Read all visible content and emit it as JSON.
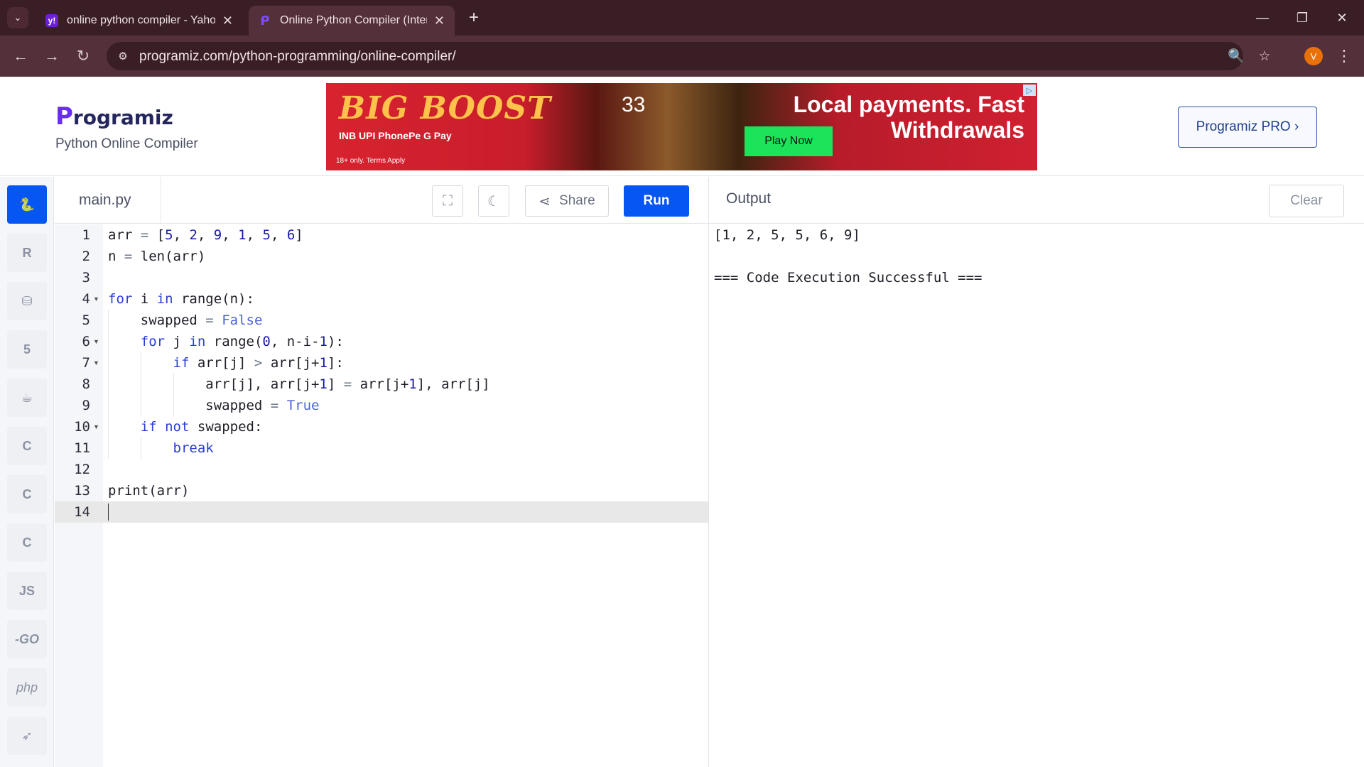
{
  "browser": {
    "tabs": [
      {
        "title": "online python compiler - Yahoo",
        "favicon": "yahoo-icon",
        "active": false
      },
      {
        "title": "Online Python Compiler (Interp",
        "favicon": "programiz-icon",
        "active": true
      }
    ],
    "url": "programiz.com/python-programming/online-compiler/",
    "profile_initial": "V",
    "accent_color": "#54303a"
  },
  "header": {
    "logo_text": "rogramiz",
    "logo_initial": "P",
    "subtitle": "Python Online Compiler",
    "pro_button": "Programiz PRO ›"
  },
  "ad": {
    "headline_left": "BIG BOOST",
    "payment_logos": "INB    UPI    PhonePe    G Pay",
    "terms": "18+ only. Terms Apply",
    "number": "33",
    "headline_right": "Local payments. Fast Withdrawals",
    "cta": "Play Now"
  },
  "sidebar": {
    "languages": [
      {
        "name": "python",
        "icon": "python-icon",
        "label": "🐍",
        "active": true
      },
      {
        "name": "r",
        "icon": "r-icon",
        "label": "R"
      },
      {
        "name": "sql",
        "icon": "database-icon",
        "label": "⛁"
      },
      {
        "name": "html",
        "icon": "html5-icon",
        "label": "5"
      },
      {
        "name": "java",
        "icon": "java-icon",
        "label": "☕"
      },
      {
        "name": "c",
        "icon": "c-icon",
        "label": "C"
      },
      {
        "name": "cpp",
        "icon": "cpp-icon",
        "label": "C"
      },
      {
        "name": "csharp",
        "icon": "csharp-icon",
        "label": "C"
      },
      {
        "name": "javascript",
        "icon": "js-icon",
        "label": "JS"
      },
      {
        "name": "go",
        "icon": "go-icon",
        "label": "-GO"
      },
      {
        "name": "php",
        "icon": "php-icon",
        "label": "php"
      },
      {
        "name": "swift",
        "icon": "swift-icon",
        "label": "➶"
      }
    ]
  },
  "editor": {
    "filename": "main.py",
    "share_label": "Share",
    "run_label": "Run",
    "run_color": "#0556f3",
    "current_line": 14,
    "lines": [
      "arr = [5, 2, 9, 1, 5, 6]",
      "n = len(arr)",
      "",
      "for i in range(n):",
      "    swapped = False",
      "    for j in range(0, n-i-1):",
      "        if arr[j] > arr[j+1]:",
      "            arr[j], arr[j+1] = arr[j+1], arr[j]",
      "            swapped = True",
      "    if not swapped:",
      "        break",
      "",
      "print(arr)",
      ""
    ]
  },
  "output": {
    "title": "Output",
    "clear_label": "Clear",
    "lines": [
      "[1, 2, 5, 5, 6, 9]",
      "",
      "=== Code Execution Successful ==="
    ]
  }
}
